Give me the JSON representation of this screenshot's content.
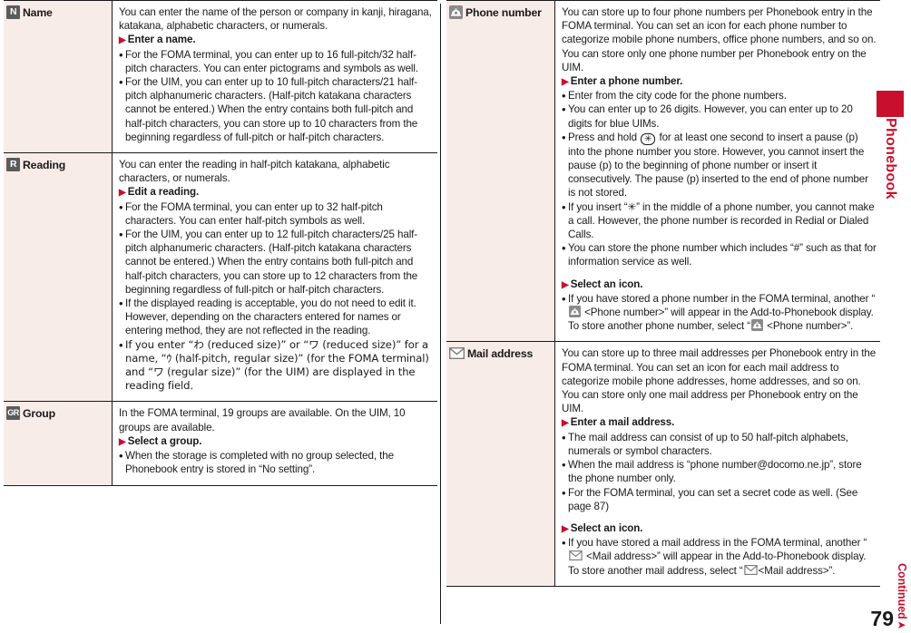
{
  "document": {
    "page_number": "79",
    "continued_label": "Continued",
    "side_tab_label": "Phonebook",
    "accent_color": "#c8102e",
    "label_bg_color": "#f8ece9",
    "badge_color": "#5b5b5b"
  },
  "left_column": {
    "rows": [
      {
        "icon": "letter-n-badge",
        "icon_text": "N",
        "label": "Name",
        "blocks": [
          {
            "type": "para",
            "text": "You can enter the name of the person or company in kanji, hiragana, katakana, alphabetic characters, or numerals."
          },
          {
            "type": "step",
            "text": "Enter a name."
          },
          {
            "type": "bullet",
            "text": "For the FOMA terminal, you can enter up to 16 full-pitch/32 half-pitch characters. You can enter pictograms and symbols as well."
          },
          {
            "type": "bullet",
            "text": "For the UIM, you can enter up to 10 full-pitch characters/21 half-pitch alphanumeric characters. (Half-pitch katakana characters cannot be entered.) When the entry contains both full-pitch and half-pitch characters, you can store up to 10 characters from the beginning regardless of full-pitch or half-pitch characters."
          }
        ]
      },
      {
        "icon": "letter-r-badge",
        "icon_text": "R",
        "label": "Reading",
        "blocks": [
          {
            "type": "para",
            "text": "You can enter the reading in half-pitch katakana, alphabetic characters, or numerals."
          },
          {
            "type": "step",
            "text": "Edit a reading."
          },
          {
            "type": "bullet",
            "text": "For the FOMA terminal, you can enter up to 32 half-pitch characters. You can enter half-pitch symbols as well."
          },
          {
            "type": "bullet",
            "text": "For the UIM, you can enter up to 12 full-pitch characters/25 half-pitch alphanumeric characters. (Half-pitch katakana characters cannot be entered.) When the entry contains both full-pitch and half-pitch characters, you can store up to 12 characters from the beginning regardless of full-pitch or half-pitch characters."
          },
          {
            "type": "bullet",
            "text": "If the displayed reading is acceptable, you do not need to edit it. However, depending on the characters entered for names or entering method, they are not reflected in the reading."
          },
          {
            "type": "bullet",
            "text": "If you enter “わ (reduced size)” or “ワ (reduced size)” for a name, “ｳ (half-pitch, regular size)” (for the FOMA terminal) and “ワ (regular size)” (for the UIM) are displayed in the reading field."
          }
        ]
      },
      {
        "icon": "letters-gr-badge",
        "icon_text": "GR",
        "label": "Group",
        "blocks": [
          {
            "type": "para",
            "text": "In the FOMA terminal, 19 groups are available. On the UIM, 10 groups are available."
          },
          {
            "type": "step",
            "text": "Select a group."
          },
          {
            "type": "bullet",
            "text": "When the storage is completed with no group selected, the Phonebook entry is stored in “No setting”."
          }
        ]
      }
    ]
  },
  "right_column": {
    "rows": [
      {
        "icon": "phone-handset-icon",
        "label": "Phone number",
        "blocks": [
          {
            "type": "para",
            "text": "You can store up to four phone numbers per Phonebook entry in the FOMA terminal. You can set an icon for each phone number to categorize mobile phone numbers, office phone numbers, and so on. You can store only one phone number per Phonebook entry on the UIM."
          },
          {
            "type": "step",
            "text": "Enter a phone number."
          },
          {
            "type": "bullet",
            "text": "Enter from the city code for the phone numbers."
          },
          {
            "type": "bullet",
            "text": "You can enter up to 26 digits. However, you can enter up to 20 digits for blue UIMs."
          },
          {
            "type": "bullet-keycap",
            "text_before": "Press and hold ",
            "keycap": "✳",
            "text_after": " for at least one second to insert a pause (p) into the phone number you store. However, you cannot insert the pause (p) to the beginning of phone number or insert it consecutively. The pause (p) inserted to the end of phone number is not stored."
          },
          {
            "type": "bullet",
            "text": "If you insert “✳” in the middle of a phone number, you cannot make a call. However, the phone number is recorded in Redial or Dialed Calls."
          },
          {
            "type": "bullet",
            "text": "You can store the phone number which includes “#” such as that for information service as well."
          },
          {
            "type": "step-spaced",
            "text": "Select an icon."
          },
          {
            "type": "bullet-icon-phone",
            "text_before": "If you have stored a phone number in the FOMA terminal, another “",
            "text_mid": " <Phone number>” will appear in the Add-to-Phonebook display. To store another phone number, select “",
            "text_after": " <Phone number>”."
          }
        ]
      },
      {
        "icon": "envelope-icon",
        "label": "Mail address",
        "blocks": [
          {
            "type": "para",
            "text": "You can store up to three mail addresses per Phonebook entry in the FOMA terminal. You can set an icon for each mail address to categorize mobile phone addresses, home addresses, and so on. You can store only one mail address per Phonebook entry on the UIM."
          },
          {
            "type": "step",
            "text": "Enter a mail address."
          },
          {
            "type": "bullet",
            "text": "The mail address can consist of up to 50 half-pitch alphabets, numerals or symbol characters."
          },
          {
            "type": "bullet",
            "text": "When the mail address is “phone number@docomo.ne.jp”, store the phone number only."
          },
          {
            "type": "bullet",
            "text": "For the FOMA terminal, you can set a secret code as well. (See page 87)"
          },
          {
            "type": "step-spaced",
            "text": "Select an icon."
          },
          {
            "type": "bullet-icon-mail",
            "text_before": "If you have stored a mail address in the FOMA terminal, another “",
            "text_mid": " <Mail address>” will appear in the Add-to-Phonebook display. To store another mail address, select “",
            "text_after": "<Mail address>”."
          }
        ]
      }
    ]
  }
}
